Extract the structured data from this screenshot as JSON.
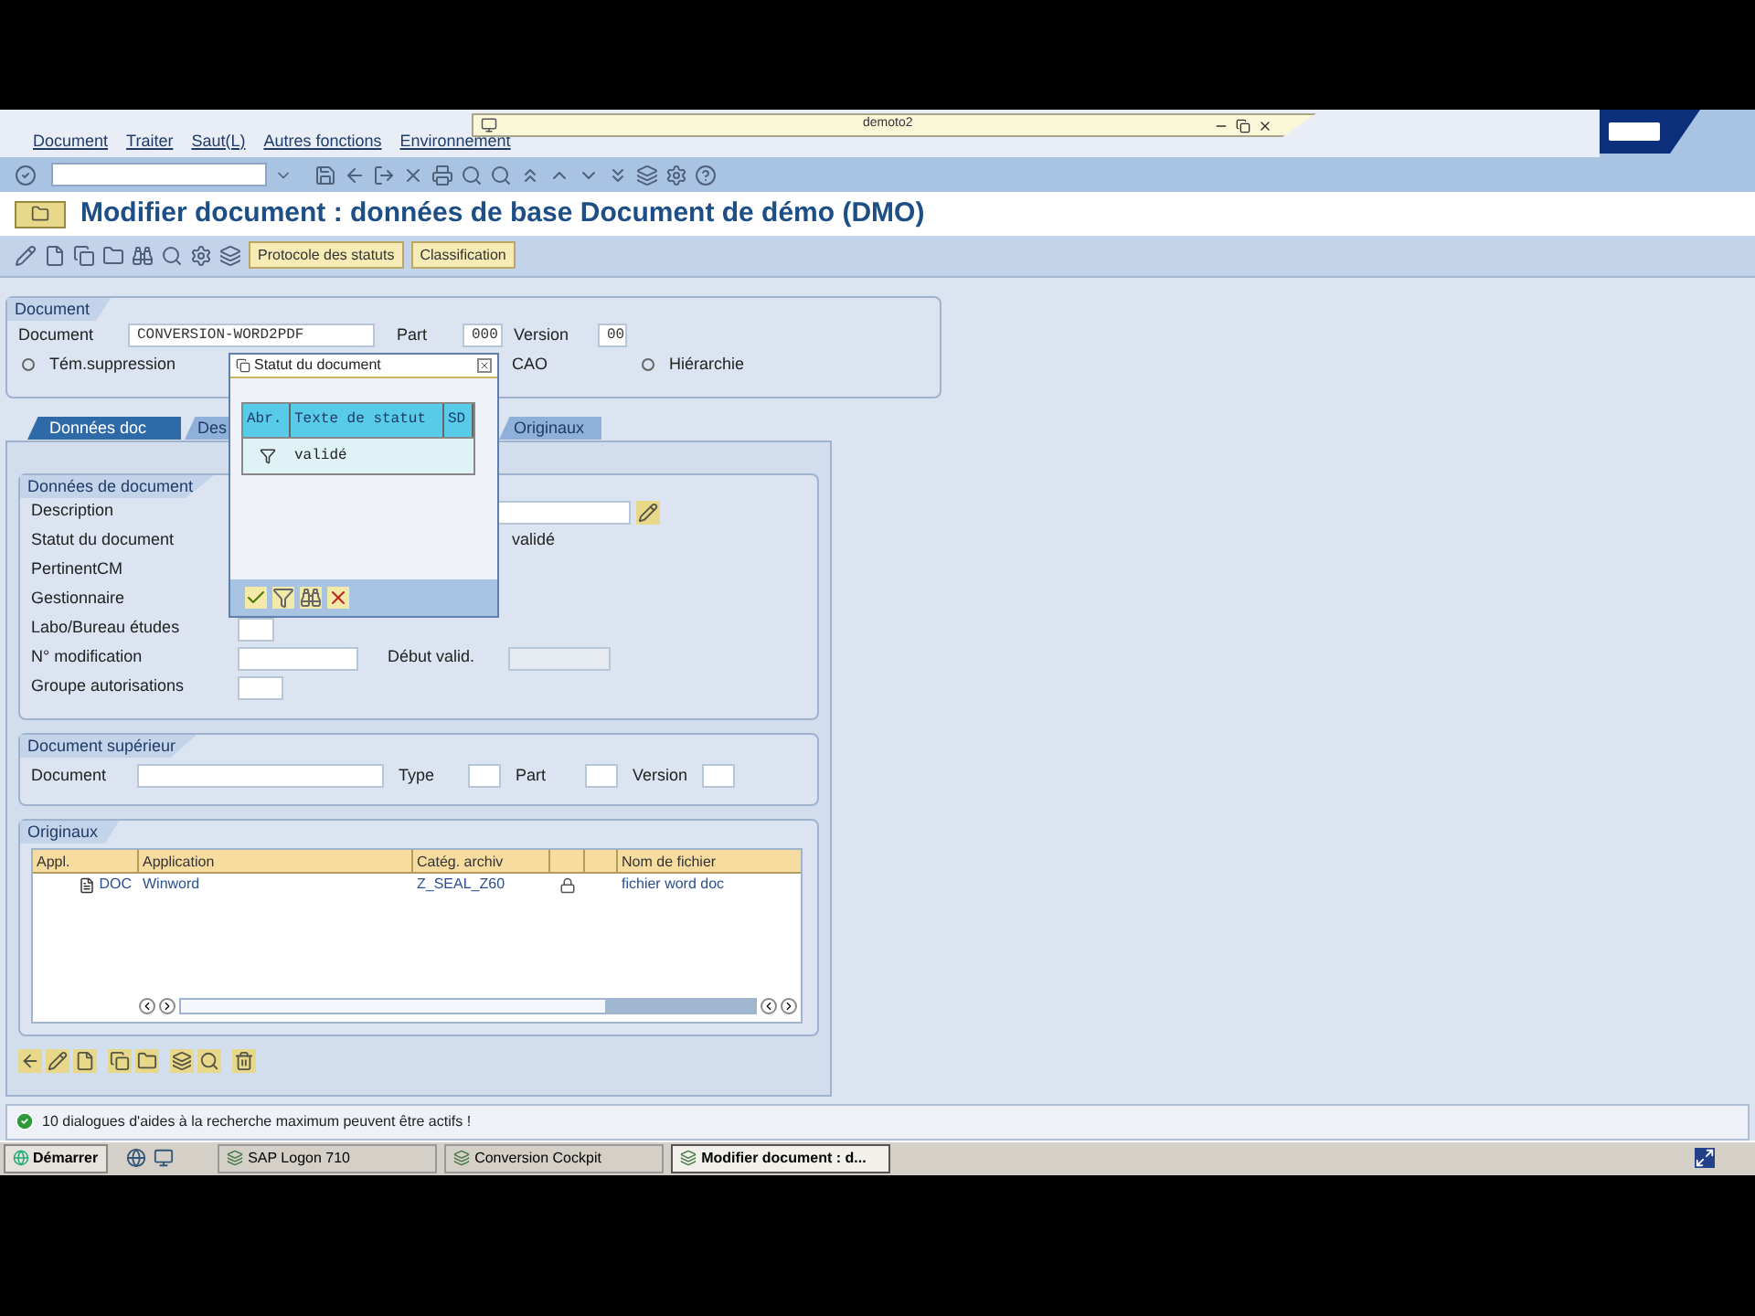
{
  "floating_window": {
    "title": "demoto2"
  },
  "menu": [
    "Document",
    "Traiter",
    "Saut(L)",
    "Autres fonctions",
    "Environnement"
  ],
  "title": "Modifier document : données de base Document de démo (DMO)",
  "app_toolbar": {
    "buttons": [
      "Protocole des statuts",
      "Classification"
    ]
  },
  "document_group": {
    "title": "Document",
    "document_label": "Document",
    "document_value": "CONVERSION-WORD2PDF",
    "part_label": "Part",
    "part_value": "000",
    "version_label": "Version",
    "version_value": "00",
    "options": [
      {
        "label": "Tém.suppression",
        "kind": "radio",
        "selected": false
      },
      {
        "label": "CAO",
        "kind": "text"
      },
      {
        "label": "Hiérarchie",
        "kind": "radio",
        "selected": false
      }
    ]
  },
  "tabs": [
    {
      "label": "Données doc",
      "selected": true
    },
    {
      "label": "Des",
      "selected": false
    },
    {
      "label": "Originaux",
      "selected": false
    }
  ],
  "document_data": {
    "title": "Données de document",
    "rows": [
      {
        "label": "Description",
        "kind": "edit"
      },
      {
        "label": "Statut du document",
        "kind": "value",
        "value": "validé"
      },
      {
        "label": "PertinentCM",
        "kind": "blank"
      },
      {
        "label": "Gestionnaire",
        "kind": "blank"
      },
      {
        "label": "Labo/Bureau études",
        "kind": "short"
      },
      {
        "label": "N° modification",
        "kind": "dated",
        "extra_label": "Début valid."
      },
      {
        "label": "Groupe autorisations",
        "kind": "short"
      }
    ]
  },
  "parent_document": {
    "title": "Document supérieur",
    "fields": [
      {
        "label": "Document",
        "kind": "long"
      },
      {
        "label": "Type",
        "kind": "short"
      },
      {
        "label": "Part",
        "kind": "short"
      },
      {
        "label": "Version",
        "kind": "short"
      }
    ]
  },
  "originals": {
    "title": "Originaux",
    "columns": [
      "Appl.",
      "Application",
      "Catég. archiv",
      "Nom de fichier"
    ],
    "rows": [
      {
        "appl": "DOC",
        "application": "Winword",
        "category": "Z_SEAL_Z60",
        "locked": true,
        "file": "fichier word doc"
      }
    ]
  },
  "popup": {
    "title": "Statut du document",
    "columns": [
      "Abr.",
      "Texte de statut",
      "SD"
    ],
    "rows": [
      {
        "text": "validé"
      }
    ]
  },
  "status_bar": {
    "message": "10 dialogues d'aides à la recherche maximum peuvent être actifs !"
  },
  "taskbar": {
    "start": "Démarrer",
    "tasks": [
      {
        "label": "SAP Logon 710",
        "selected": false
      },
      {
        "label": "Conversion Cockpit",
        "selected": false
      },
      {
        "label": "Modifier document : d...",
        "selected": true
      }
    ]
  }
}
